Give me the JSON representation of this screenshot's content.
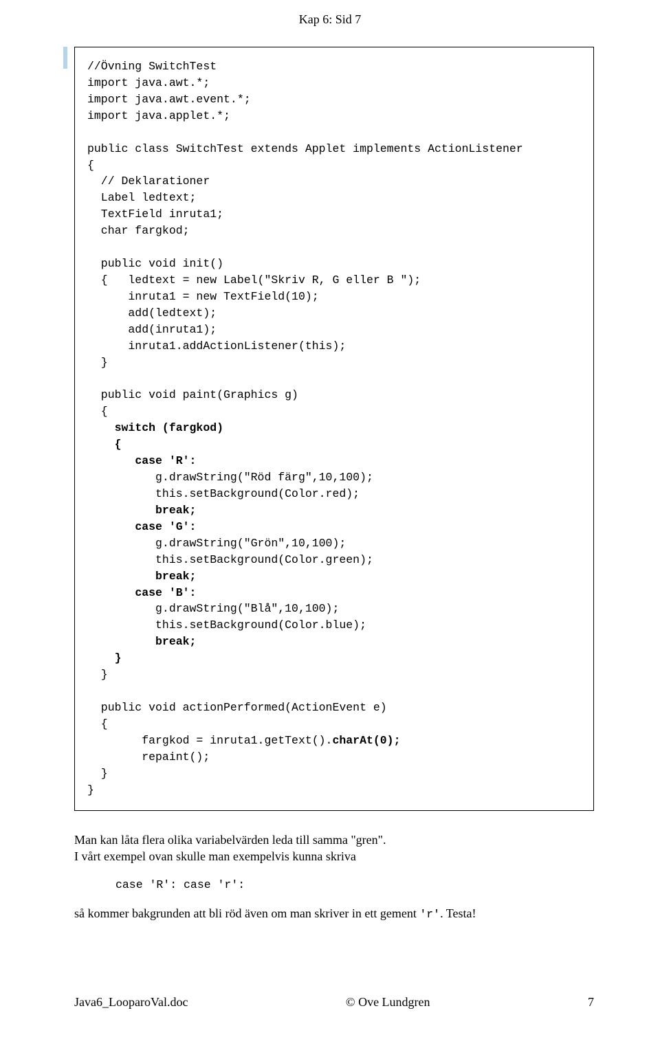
{
  "header": "Kap 6:  Sid 7",
  "code": {
    "l01": "//Övning SwitchTest",
    "l02": "import java.awt.*;",
    "l03": "import java.awt.event.*;",
    "l04": "import java.applet.*;",
    "l05": "",
    "l06": "public class SwitchTest extends Applet implements ActionListener",
    "l07": "{",
    "l08": "  // Deklarationer",
    "l09": "  Label ledtext;",
    "l10": "  TextField inruta1;",
    "l11": "  char fargkod;",
    "l12": "",
    "l13": "  public void init()",
    "l14": "  {   ledtext = new Label(\"Skriv R, G eller B \");",
    "l15": "      inruta1 = new TextField(10);",
    "l16": "      add(ledtext);",
    "l17": "      add(inruta1);",
    "l18": "      inruta1.addActionListener(this);",
    "l19": "  }",
    "l20": "",
    "l21": "  public void paint(Graphics g)",
    "l22": "  {",
    "l23a": "    ",
    "l23b": "switch (fargkod)",
    "l24a": "    ",
    "l24b": "{",
    "l25a": "       ",
    "l25b": "case 'R':",
    "l26": "          g.drawString(\"Röd färg\",10,100);",
    "l27": "          this.setBackground(Color.red);",
    "l28a": "          ",
    "l28b": "break;",
    "l29a": "       ",
    "l29b": "case 'G':",
    "l30": "          g.drawString(\"Grön\",10,100);",
    "l31": "          this.setBackground(Color.green);",
    "l32a": "          ",
    "l32b": "break;",
    "l33a": "       ",
    "l33b": "case 'B':",
    "l34": "          g.drawString(\"Blå\",10,100);",
    "l35": "          this.setBackground(Color.blue);",
    "l36a": "          ",
    "l36b": "break;",
    "l37a": "    ",
    "l37b": "}",
    "l38": "  }",
    "l39": "",
    "l40": "  public void actionPerformed(ActionEvent e)",
    "l41": "  {",
    "l42a": "        fargkod = inruta1.getText().",
    "l42b": "charAt(0);",
    "l43": "        repaint();",
    "l44": "  }",
    "l45": "}"
  },
  "para1a": "Man kan låta  flera olika variabelvärden  leda till samma \"gren\".",
  "para1b": "I vårt exempel ovan skulle man exempelvis kunna skriva",
  "indent_code": "case 'R': case 'r':",
  "para2a": "så kommer bakgrunden att bli röd även om man skriver in ett gement ",
  "para2b": "'r'",
  "para2c": ".   Testa!",
  "footer_left": "Java6_LooparoVal.doc",
  "footer_center": "© Ove Lundgren",
  "footer_right": "7"
}
